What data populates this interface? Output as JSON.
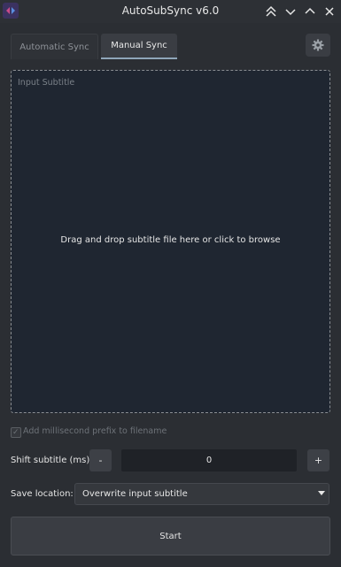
{
  "window": {
    "title": "AutoSubSync v6.0",
    "controls": [
      "keep-above-icon",
      "minimize-icon",
      "maximize-icon"
    ]
  },
  "tabs": [
    {
      "label": "Automatic Sync",
      "active": false
    },
    {
      "label": "Manual Sync",
      "active": true
    }
  ],
  "settings": {
    "icon": "gear-icon"
  },
  "dropzone": {
    "label": "Input Subtitle",
    "message": "Drag and drop subtitle file here or click to browse"
  },
  "options": {
    "millisecond_prefix_label": "Add millisecond prefix to filename",
    "millisecond_prefix_checked": true,
    "millisecond_prefix_enabled": false
  },
  "shift": {
    "label": "Shift subtitle (ms)",
    "minus_label": "-",
    "plus_label": "+",
    "value": "0"
  },
  "save": {
    "label": "Save location:",
    "selected": "Overwrite input subtitle"
  },
  "actions": {
    "start_label": "Start"
  },
  "colors": {
    "background": "#2b2e33",
    "dropzone_bg": "#1f2631",
    "tab_active_underline": "#8fa6b9"
  }
}
